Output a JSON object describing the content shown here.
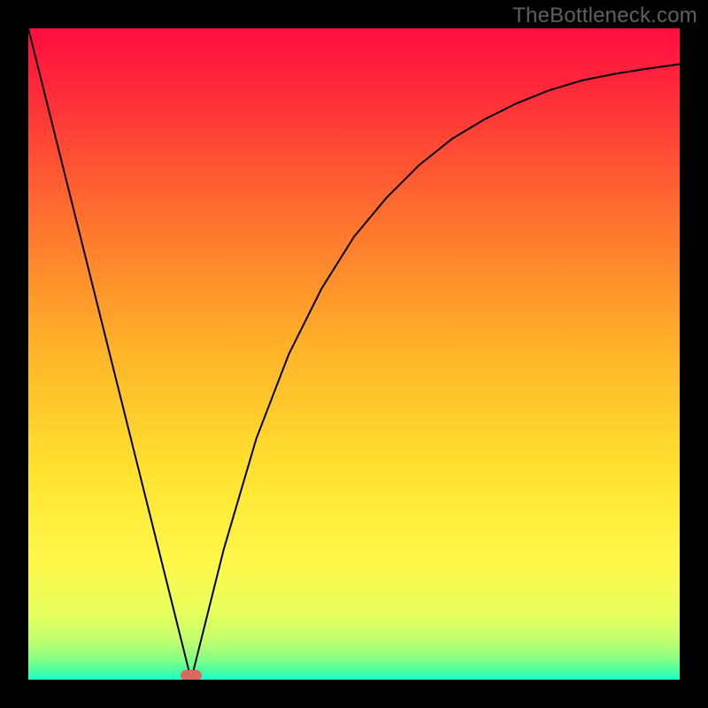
{
  "watermark": "TheBottleneck.com",
  "chart_data": {
    "type": "line",
    "title": "",
    "xlabel": "",
    "ylabel": "",
    "xlim": [
      0,
      100
    ],
    "ylim": [
      0,
      100
    ],
    "x": [
      0,
      5,
      10,
      15,
      20,
      22,
      24,
      25,
      26,
      28,
      30,
      35,
      40,
      45,
      50,
      55,
      60,
      65,
      70,
      75,
      80,
      85,
      90,
      95,
      100
    ],
    "values": [
      100,
      80,
      60,
      40,
      20,
      12,
      4,
      0,
      4,
      12,
      20,
      37,
      50,
      60,
      68,
      74,
      79,
      83,
      86,
      88.5,
      90.5,
      92,
      93,
      93.8,
      94.5
    ],
    "minimum": {
      "x": 25,
      "y": 0
    },
    "gradient_stops": [
      {
        "offset": 0.0,
        "color": "#ff0e40"
      },
      {
        "offset": 0.08,
        "color": "#ff253b"
      },
      {
        "offset": 0.28,
        "color": "#ff6d2f"
      },
      {
        "offset": 0.5,
        "color": "#ffb528"
      },
      {
        "offset": 0.68,
        "color": "#ffe22f"
      },
      {
        "offset": 0.82,
        "color": "#fff84a"
      },
      {
        "offset": 0.9,
        "color": "#e6ff5c"
      },
      {
        "offset": 0.94,
        "color": "#c0ff70"
      },
      {
        "offset": 0.965,
        "color": "#8dff80"
      },
      {
        "offset": 0.985,
        "color": "#4effa0"
      },
      {
        "offset": 1.0,
        "color": "#17ffc8"
      }
    ],
    "marker_color": "#d86a5f",
    "curve_color": "#000000",
    "curve_width": 2
  }
}
